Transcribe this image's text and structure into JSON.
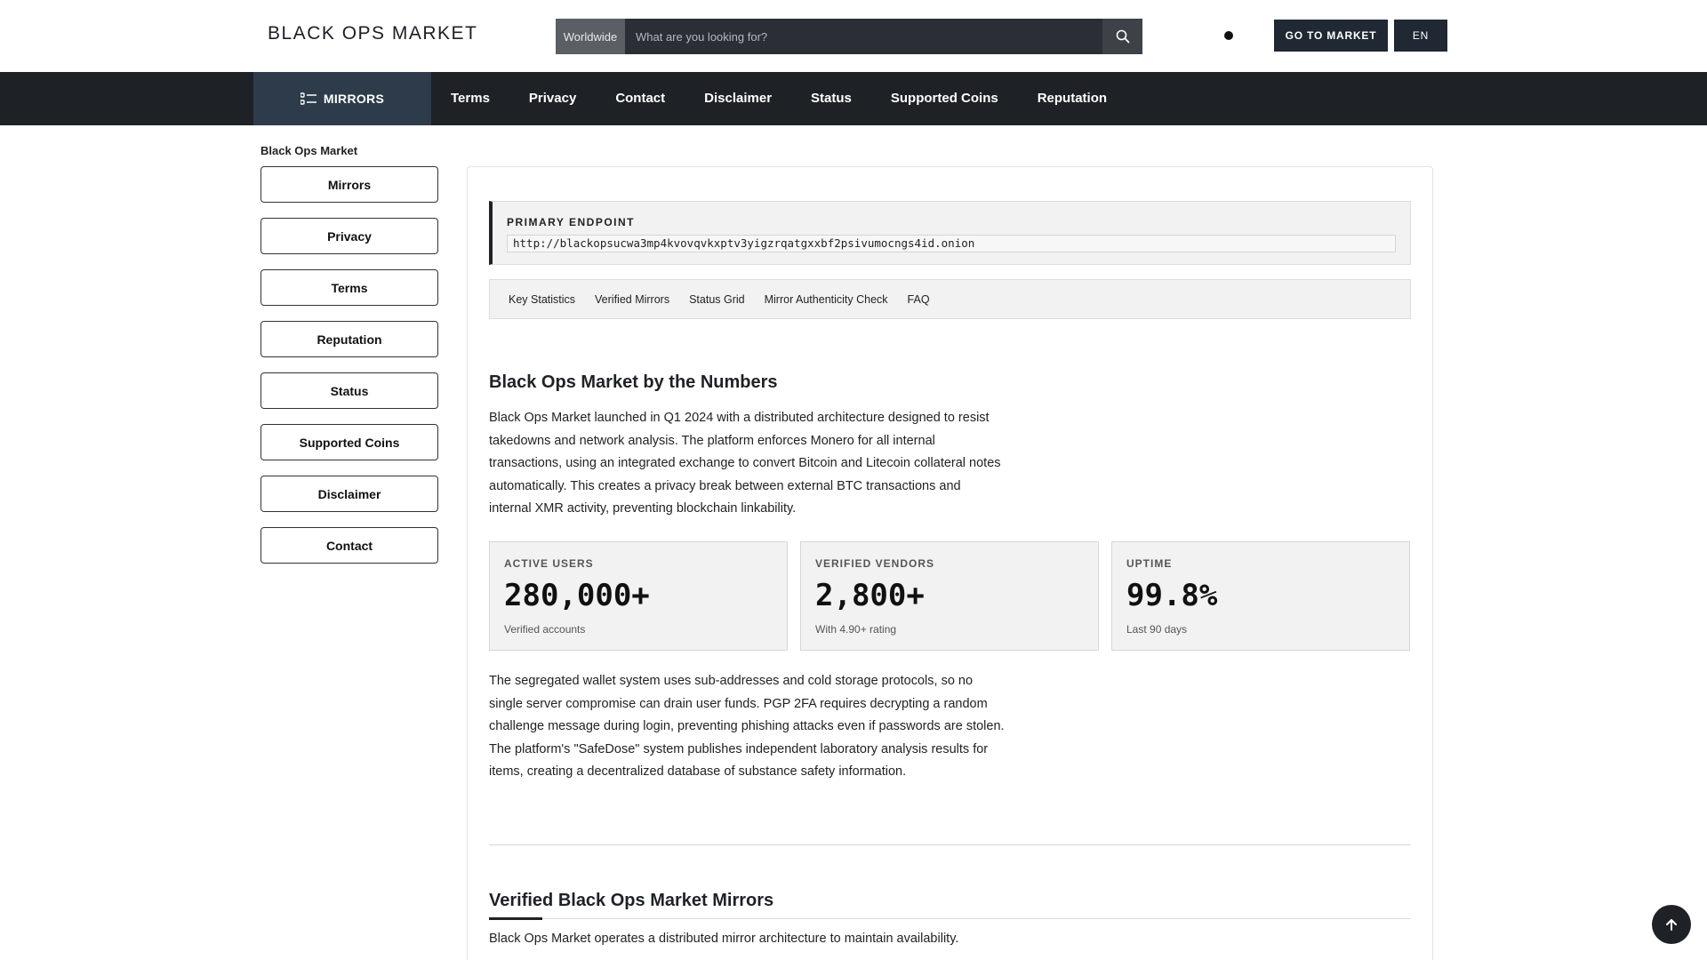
{
  "header": {
    "logo": "BLACK OPS MARKET",
    "search_scope": "Worldwide",
    "search_placeholder": "What are you looking for?",
    "go_market": "GO TO MARKET",
    "lang": "EN",
    "icons": {
      "search": "search-icon",
      "theme": "theme-toggle-icon"
    }
  },
  "nav": {
    "mirrors": "MIRRORS",
    "items": [
      "Terms",
      "Privacy",
      "Contact",
      "Disclaimer",
      "Status",
      "Supported Coins",
      "Reputation"
    ]
  },
  "sidebar": {
    "title": "Black Ops Market",
    "items": [
      "Mirrors",
      "Privacy",
      "Terms",
      "Reputation",
      "Status",
      "Supported Coins",
      "Disclaimer",
      "Contact"
    ]
  },
  "endpoint": {
    "label": "PRIMARY ENDPOINT",
    "url": "http://blackopsucwa3mp4kvovqvkxptv3yigzrqatgxxbf2psivumocngs4id.onion"
  },
  "tabs": [
    "Key Statistics",
    "Verified Mirrors",
    "Status Grid",
    "Mirror Authenticity Check",
    "FAQ"
  ],
  "section1": {
    "title": "Black Ops Market by the Numbers",
    "para1": "Black Ops Market launched in Q1 2024 with a distributed architecture designed to resist takedowns and network analysis. The platform enforces Monero for all internal transactions, using an integrated exchange to convert Bitcoin and Litecoin collateral notes automatically. This creates a privacy break between external BTC transactions and internal XMR activity, preventing blockchain linkability.",
    "para2": "The segregated wallet system uses sub-addresses and cold storage protocols, so no single server compromise can drain user funds. PGP 2FA requires decrypting a random challenge message during login, preventing phishing attacks even if passwords are stolen. The platform's \"SafeDose\" system publishes independent laboratory analysis results for items, creating a decentralized database of substance safety information."
  },
  "stats": [
    {
      "label": "ACTIVE USERS",
      "value": "280,000+",
      "sub": "Verified accounts"
    },
    {
      "label": "VERIFIED VENDORS",
      "value": "2,800+",
      "sub": "With 4.90+ rating"
    },
    {
      "label": "UPTIME",
      "value": "99.8%",
      "sub": "Last 90 days"
    }
  ],
  "section2": {
    "title": "Verified Black Ops Market Mirrors",
    "para": "Black Ops Market operates a distributed mirror architecture to maintain availability."
  },
  "colors": {
    "nav_bg": "#1e2227",
    "nav_active": "#2e3b4b",
    "button_dark": "#1f2833"
  }
}
